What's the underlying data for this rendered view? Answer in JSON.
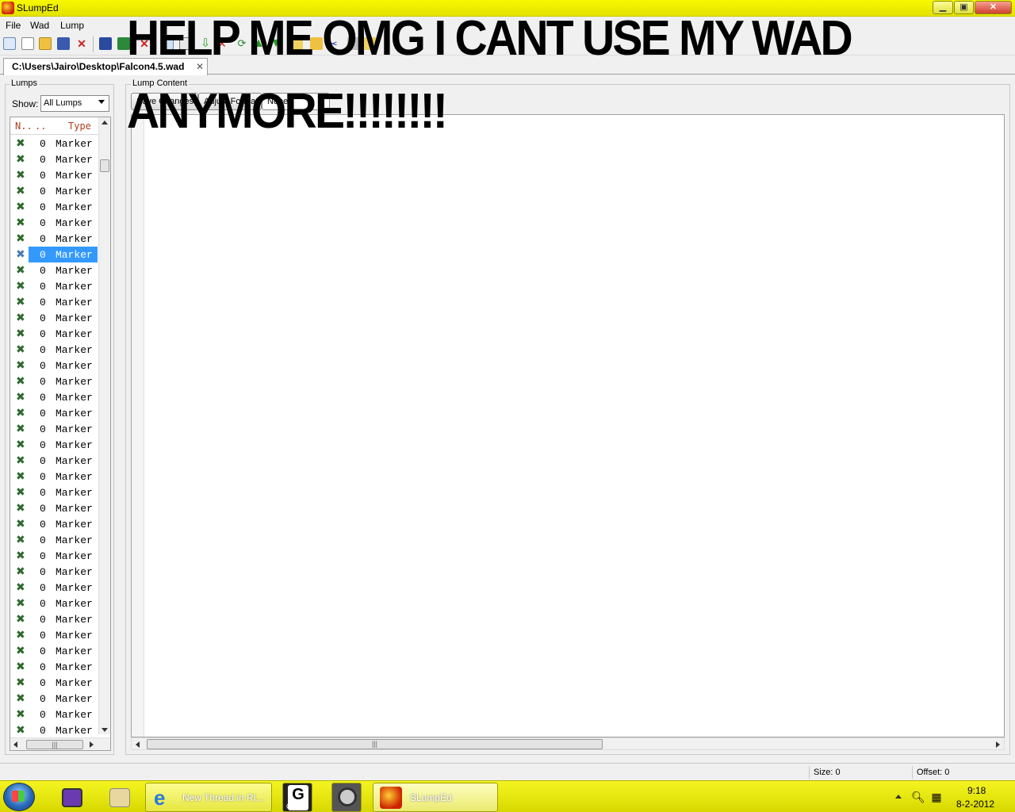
{
  "window": {
    "title": "SLumpEd",
    "controls": {
      "minimize": "▁",
      "maximize": "▣",
      "close": "✕"
    }
  },
  "menu": [
    "File",
    "Wad",
    "Lump"
  ],
  "toolbar": {
    "icons": [
      "new-wad-icon",
      "new-file-icon",
      "open-folder-icon",
      "save-wad-icon",
      "close-wad-icon",
      "save-icon",
      "save-as-icon",
      "delete-icon",
      "copy-icon",
      "paste-icon",
      "import-icon",
      "export-icon",
      "move-up-icon",
      "move-down-icon",
      "rename-icon",
      "cut-icon",
      "lock-icon"
    ]
  },
  "tab": {
    "label": "C:\\Users\\Jairo\\Desktop\\Falcon4.5.wad",
    "close": "✕"
  },
  "lumps_panel": {
    "title": "Lumps",
    "show_label": "Show:",
    "show_value": "All Lumps",
    "columns": [
      "N..",
      "..",
      "Type"
    ],
    "rows": [
      {
        "size": "0",
        "type": "Marker"
      },
      {
        "size": "0",
        "type": "Marker"
      },
      {
        "size": "0",
        "type": "Marker"
      },
      {
        "size": "0",
        "type": "Marker"
      },
      {
        "size": "0",
        "type": "Marker"
      },
      {
        "size": "0",
        "type": "Marker"
      },
      {
        "size": "0",
        "type": "Marker"
      },
      {
        "size": "0",
        "type": "Marker",
        "selected": true
      },
      {
        "size": "0",
        "type": "Marker"
      },
      {
        "size": "0",
        "type": "Marker"
      },
      {
        "size": "0",
        "type": "Marker"
      },
      {
        "size": "0",
        "type": "Marker"
      },
      {
        "size": "0",
        "type": "Marker"
      },
      {
        "size": "0",
        "type": "Marker"
      },
      {
        "size": "0",
        "type": "Marker"
      },
      {
        "size": "0",
        "type": "Marker"
      },
      {
        "size": "0",
        "type": "Marker"
      },
      {
        "size": "0",
        "type": "Marker"
      },
      {
        "size": "0",
        "type": "Marker"
      },
      {
        "size": "0",
        "type": "Marker"
      },
      {
        "size": "0",
        "type": "Marker"
      },
      {
        "size": "0",
        "type": "Marker"
      },
      {
        "size": "0",
        "type": "Marker"
      },
      {
        "size": "0",
        "type": "Marker"
      },
      {
        "size": "0",
        "type": "Marker"
      },
      {
        "size": "0",
        "type": "Marker"
      },
      {
        "size": "0",
        "type": "Marker"
      },
      {
        "size": "0",
        "type": "Marker"
      },
      {
        "size": "0",
        "type": "Marker"
      },
      {
        "size": "0",
        "type": "Marker"
      },
      {
        "size": "0",
        "type": "Marker"
      },
      {
        "size": "0",
        "type": "Marker"
      },
      {
        "size": "0",
        "type": "Marker"
      },
      {
        "size": "0",
        "type": "Marker"
      },
      {
        "size": "0",
        "type": "Marker"
      },
      {
        "size": "0",
        "type": "Marker"
      },
      {
        "size": "0",
        "type": "Marker"
      },
      {
        "size": "0",
        "type": "Marker"
      }
    ]
  },
  "content_panel": {
    "title": "Lump Content",
    "buttons": [
      "Save Changes",
      "Adjust Format",
      "None"
    ]
  },
  "status": {
    "size": "Size: 0",
    "offset": "Offset: 0"
  },
  "overlay": {
    "line1": "HELP ME OMG I CANT USE MY WAD",
    "line2": "ANYMORE!!!!!!!!"
  },
  "taskbar": {
    "tasks": [
      "New Thread in Ri...",
      "Gens",
      "SLumpEd"
    ],
    "clock_time": "9:18",
    "clock_date": "8-2-2012"
  },
  "colors": {
    "titlebar": "#f0f000",
    "selection": "#3399ff",
    "marker_icon": "#2d6a2d",
    "header_text": "#b04020"
  }
}
